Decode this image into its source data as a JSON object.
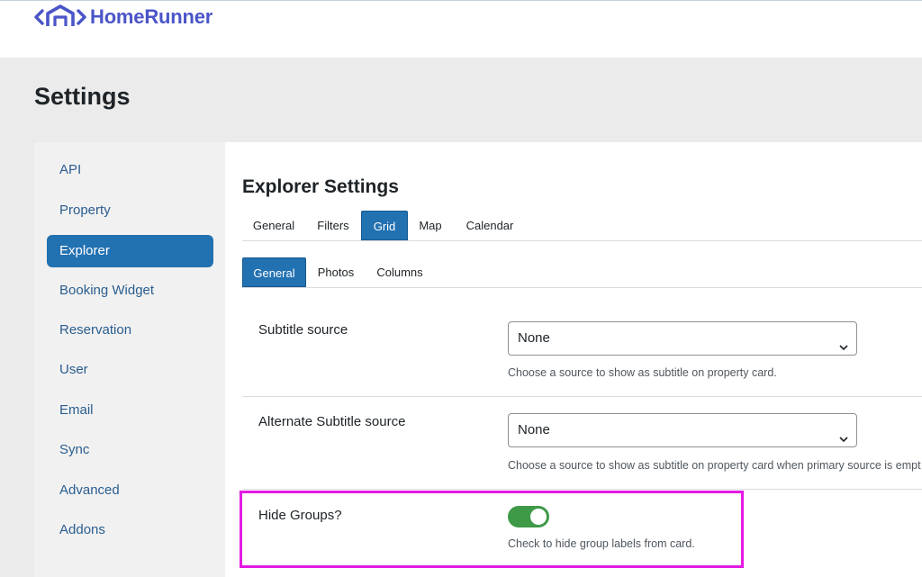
{
  "brand": {
    "name": "HomeRunner",
    "color": "#4a55c8"
  },
  "page": {
    "title": "Settings"
  },
  "sidebar": {
    "active": "Explorer",
    "items": [
      {
        "label": "API"
      },
      {
        "label": "Property"
      },
      {
        "label": "Explorer"
      },
      {
        "label": "Booking Widget"
      },
      {
        "label": "Reservation"
      },
      {
        "label": "User"
      },
      {
        "label": "Email"
      },
      {
        "label": "Sync"
      },
      {
        "label": "Advanced"
      },
      {
        "label": "Addons"
      }
    ]
  },
  "panel": {
    "title": "Explorer Settings",
    "tabs": [
      {
        "label": "General"
      },
      {
        "label": "Filters"
      },
      {
        "label": "Grid"
      },
      {
        "label": "Map"
      },
      {
        "label": "Calendar"
      }
    ],
    "active_tab": "Grid",
    "subtabs": [
      {
        "label": "General"
      },
      {
        "label": "Photos"
      },
      {
        "label": "Columns"
      }
    ],
    "active_subtab": "General",
    "fields": [
      {
        "label": "Subtitle source",
        "value": "None",
        "help": "Choose a source to show as subtitle on property card."
      },
      {
        "label": "Alternate Subtitle source",
        "value": "None",
        "help": "Choose a source to show as subtitle on property card when primary source is empt"
      },
      {
        "label": "Hide Groups?",
        "checked": true,
        "help": "Check to hide group labels from card."
      }
    ]
  },
  "colors": {
    "accent": "#2271b1",
    "toggle_on": "#3f9a48",
    "highlight": "#e31be3"
  }
}
